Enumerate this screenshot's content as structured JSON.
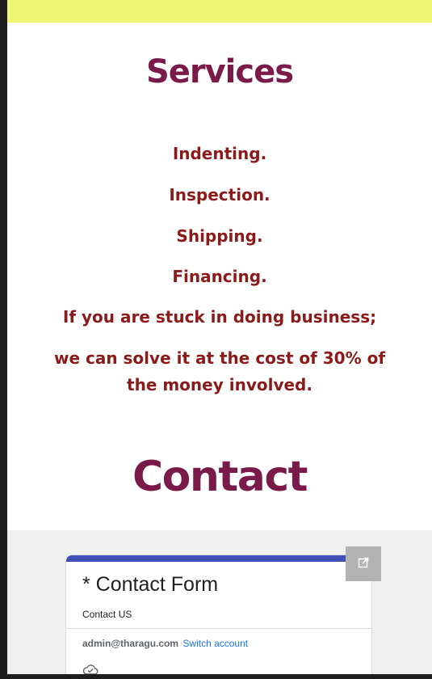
{
  "services": {
    "title": "Services",
    "lines": [
      "Indenting.",
      "Inspection.",
      "Shipping.",
      "Financing.",
      "If you are stuck in doing business;",
      "we can solve it at the cost of 30% of the money involved."
    ]
  },
  "contact": {
    "title": "Contact"
  },
  "form": {
    "title": "* Contact Form",
    "description": "Contact US",
    "account_email": "admin@tharagu.com",
    "switch_account_label": "Switch account",
    "open_icon": "open-in-new-icon",
    "cloud_icon": "cloud-check-icon",
    "accent_color": "#3f51b5"
  },
  "colors": {
    "top_band": "#f0f776",
    "heading": "#7a1a4a",
    "service_text": "#8b1a1a"
  }
}
